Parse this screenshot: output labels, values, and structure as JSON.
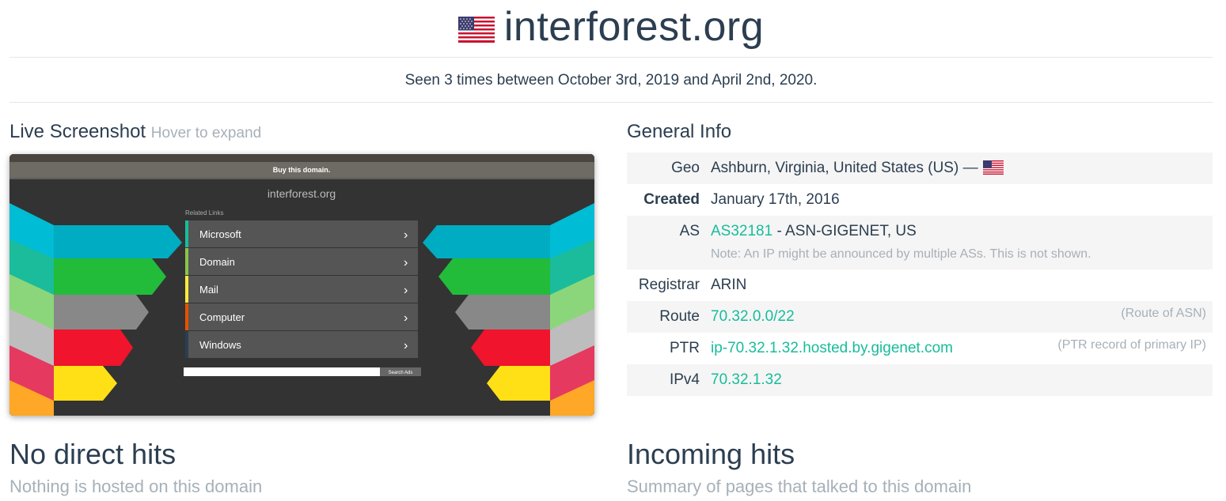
{
  "header": {
    "domain": "interforest.org",
    "flag_icon": "us-flag-icon"
  },
  "seen_text": "Seen 3 times between October 3rd, 2019 and April 2nd, 2020.",
  "screenshot": {
    "title": "Live Screenshot",
    "hint": "Hover to expand",
    "site": {
      "banner": "Buy this domain.",
      "domain": "interforest.org",
      "related_label": "Related Links",
      "links": [
        "Microsoft",
        "Domain",
        "Mail",
        "Computer",
        "Windows"
      ],
      "search_button": "Search Ads"
    }
  },
  "general": {
    "title": "General Info",
    "geo_label": "Geo",
    "geo_value": "Ashburn, Virginia, United States (US) —",
    "created_label": "Created",
    "created_value": "January 17th, 2016",
    "as_label": "AS",
    "as_link": "AS32181",
    "as_rest": " - ASN-GIGENET, US",
    "as_note": "Note: An IP might be announced by multiple ASs. This is not shown.",
    "registrar_label": "Registrar",
    "registrar_value": "ARIN",
    "route_label": "Route",
    "route_value": "70.32.0.0/22",
    "route_side": "(Route of ASN)",
    "ptr_label": "PTR",
    "ptr_value": "ip-70.32.1.32.hosted.by.gigenet.com",
    "ptr_side": "(PTR record of primary IP)",
    "ipv4_label": "IPv4",
    "ipv4_value": "70.32.1.32"
  },
  "direct": {
    "title": "No direct hits",
    "subtitle": "Nothing is hosted on this domain"
  },
  "incoming": {
    "title": "Incoming hits",
    "subtitle": "Summary of pages that talked to this domain"
  },
  "colors": {
    "accent": "#18bc9c",
    "text": "#2c3e50",
    "muted": "#a7b0b8"
  }
}
